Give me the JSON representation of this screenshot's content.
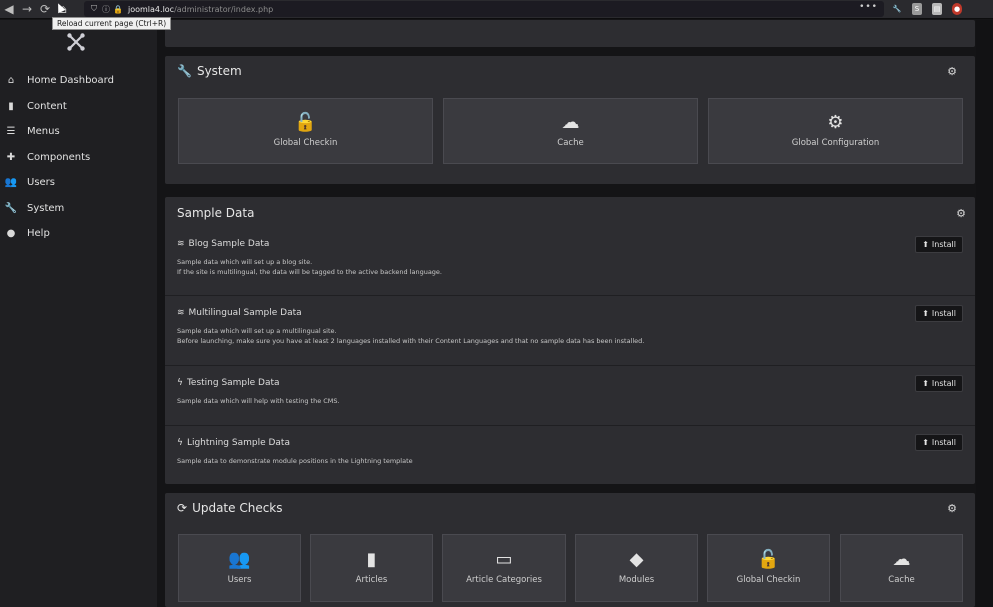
{
  "browser": {
    "url_host": "joomla4.loc",
    "url_path": "/administrator/index.php",
    "tooltip": "Reload current page (Ctrl+R)",
    "more": "•••"
  },
  "sidebar": {
    "items": [
      {
        "label": "Home Dashboard",
        "icon": "home-icon"
      },
      {
        "label": "Content",
        "icon": "file-icon"
      },
      {
        "label": "Menus",
        "icon": "list-icon"
      },
      {
        "label": "Components",
        "icon": "puzzle-icon"
      },
      {
        "label": "Users",
        "icon": "users-icon"
      },
      {
        "label": "System",
        "icon": "wrench-icon"
      },
      {
        "label": "Help",
        "icon": "info-icon"
      }
    ]
  },
  "system": {
    "title": "System",
    "tiles": [
      {
        "label": "Global Checkin",
        "icon": "unlock-icon"
      },
      {
        "label": "Cache",
        "icon": "cloud-icon"
      },
      {
        "label": "Global Configuration",
        "icon": "cog-icon"
      }
    ]
  },
  "sample_data": {
    "title": "Sample Data",
    "items": [
      {
        "title": "Blog Sample Data",
        "icon": "wifi-icon",
        "desc1": "Sample data which will set up a blog site.",
        "desc2": "If the site is multilingual, the data will be tagged to the active backend language.",
        "button": "Install"
      },
      {
        "title": "Multilingual Sample Data",
        "icon": "wifi-icon",
        "desc1": "Sample data which will set up a multilingual site.",
        "desc2": "Before launching, make sure you have at least 2 languages installed with their Content Languages and that no sample data has been installed.",
        "button": "Install"
      },
      {
        "title": "Testing Sample Data",
        "icon": "bolt-icon",
        "desc1": "Sample data which will help with testing the CMS.",
        "desc2": "",
        "button": "Install"
      },
      {
        "title": "Lightning Sample Data",
        "icon": "bolt-icon",
        "desc1": "Sample data to demonstrate module positions in the Lightning template",
        "desc2": "",
        "button": "Install"
      }
    ]
  },
  "update_checks": {
    "title": "Update Checks",
    "tiles": [
      {
        "label": "Users",
        "icon": "users-icon"
      },
      {
        "label": "Articles",
        "icon": "file-icon"
      },
      {
        "label": "Article Categories",
        "icon": "folder-icon"
      },
      {
        "label": "Modules",
        "icon": "cube-icon"
      },
      {
        "label": "Global Checkin",
        "icon": "unlock-icon"
      },
      {
        "label": "Cache",
        "icon": "cloud-icon"
      }
    ]
  }
}
